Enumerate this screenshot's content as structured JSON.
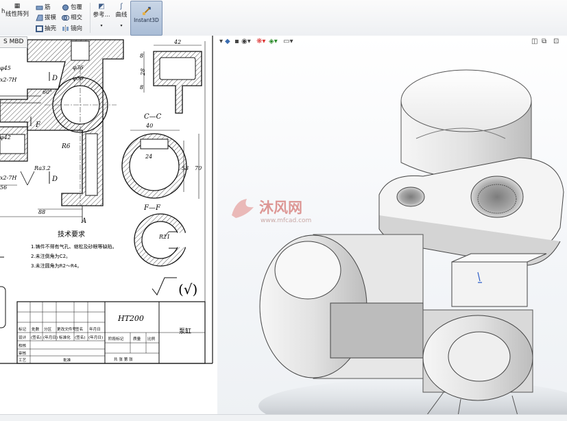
{
  "ribbon": {
    "linear_pattern": "线性阵列",
    "rib": "筋",
    "draft": "拔模",
    "shell": "抽壳",
    "wrap": "包覆",
    "intersect": "相交",
    "mirror": "镜向",
    "reference": "参考...",
    "curves": "曲线",
    "instant3d": "Instant3D"
  },
  "tab": {
    "mbd": "S MBD"
  },
  "drawing": {
    "dim_42": "42",
    "dim_phi36": "φ36",
    "dim_phi50": "φ50",
    "dim_28": "28",
    "dim_8a": "8",
    "dim_8b": "8",
    "dim_phi45": "φ45",
    "dim_thread1": "x2-7H",
    "dim_60": "60°",
    "label_D1": "D",
    "label_F": "F",
    "dim_phi42": "φ42",
    "dim_R6": "R6",
    "dim_ra": "Ra3.2",
    "dim_thread2": "x2-7H",
    "label_D2": "D",
    "dim_56": "56",
    "dim_88": "88",
    "label_A": "A",
    "section_CC": "C—C",
    "dim_40": "40",
    "dim_24": "24",
    "dim_53": "53",
    "dim_70": "70",
    "section_FF": "F—F",
    "dim_R21": "R21",
    "tech_title": "技术要求",
    "tech_1": "1.铸件不得有气孔、缩松及砂眼等缺陷。",
    "tech_2": "2.未注倒角为C2。",
    "tech_3": "3.未注圆角为R2～R4。",
    "roughness": "√",
    "material": "HT200",
    "part_name": "泵缸",
    "tb_r1": [
      "标记",
      "处数",
      "分区",
      "更改文件号",
      "签名",
      "年月日"
    ],
    "tb_r2": [
      "设计",
      "(签名)",
      "(年月日)",
      "标准化",
      "(签名)",
      "(年月日)"
    ],
    "tb_r3": [
      "校核"
    ],
    "tb_r4": [
      "审核"
    ],
    "tb_r5": [
      "工艺"
    ],
    "tb_approve": "批准",
    "tb_stage": "阶段标记",
    "tb_weight": "质量",
    "tb_scale": "比例",
    "tb_sheets": "共  张  第  张"
  },
  "watermark": {
    "brand": "沐风网",
    "url": "www.mfcad.com"
  },
  "colors": {
    "accent": "#a9bcd6",
    "watermark": "#d9534f"
  }
}
